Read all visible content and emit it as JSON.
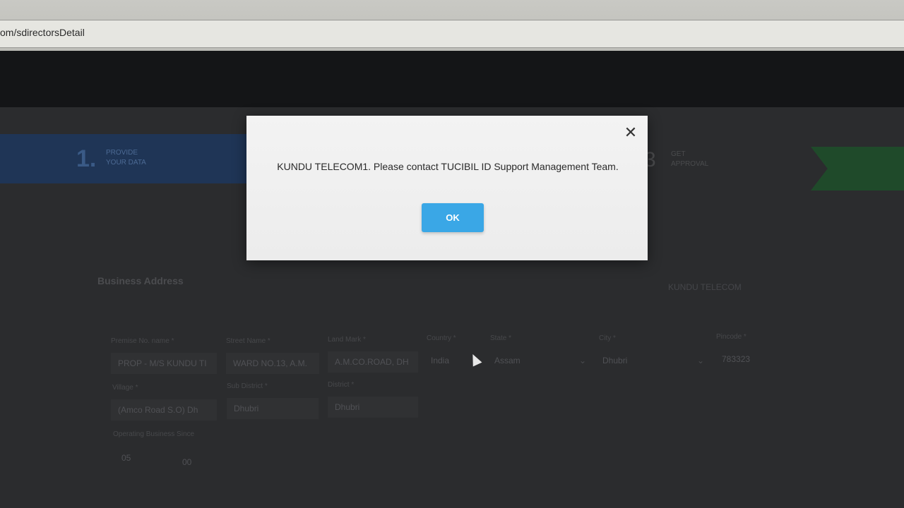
{
  "browser": {
    "url": "om/sdirectorsDetail"
  },
  "stepper": {
    "step1": {
      "number": "1.",
      "label_line1": "PROVIDE",
      "label_line2": "YOUR DATA"
    },
    "step3": {
      "number": "3",
      "label_line1": "GET",
      "label_line2": "APPROVAL"
    }
  },
  "section": {
    "title": "Business Address",
    "company": "KUNDU TELECOM"
  },
  "fields": {
    "premise": {
      "label": "Premise No. name *",
      "value": "PROP - M/S KUNDU TI"
    },
    "street": {
      "label": "Street Name *",
      "value": "WARD NO.13, A.M."
    },
    "landmark": {
      "label": "Land Mark *",
      "value": "A.M.CO.ROAD, DH"
    },
    "country": {
      "label": "Country *",
      "value": "India"
    },
    "state": {
      "label": "State *",
      "value": "Assam"
    },
    "city": {
      "label": "City *",
      "value": "Dhubri"
    },
    "pincode": {
      "label": "Pincode *",
      "value": "783323"
    },
    "village": {
      "label": "Village *",
      "value": "(Amco Road S.O) Dh"
    },
    "subdistrict": {
      "label": "Sub District *",
      "value": "Dhubri"
    },
    "district": {
      "label": "District *",
      "value": "Dhubri"
    },
    "operating_since": {
      "label": "Operating Business Since",
      "value1": "05",
      "value2": "00"
    }
  },
  "modal": {
    "message": "KUNDU TELECOM1. Please contact TUCIBIL ID Support Management Team.",
    "ok_label": "OK",
    "close_glyph": "✕"
  },
  "colors": {
    "ok_button": "#3aa7e6",
    "step_active": "#1f3556",
    "step_done": "#1f4a2a"
  }
}
